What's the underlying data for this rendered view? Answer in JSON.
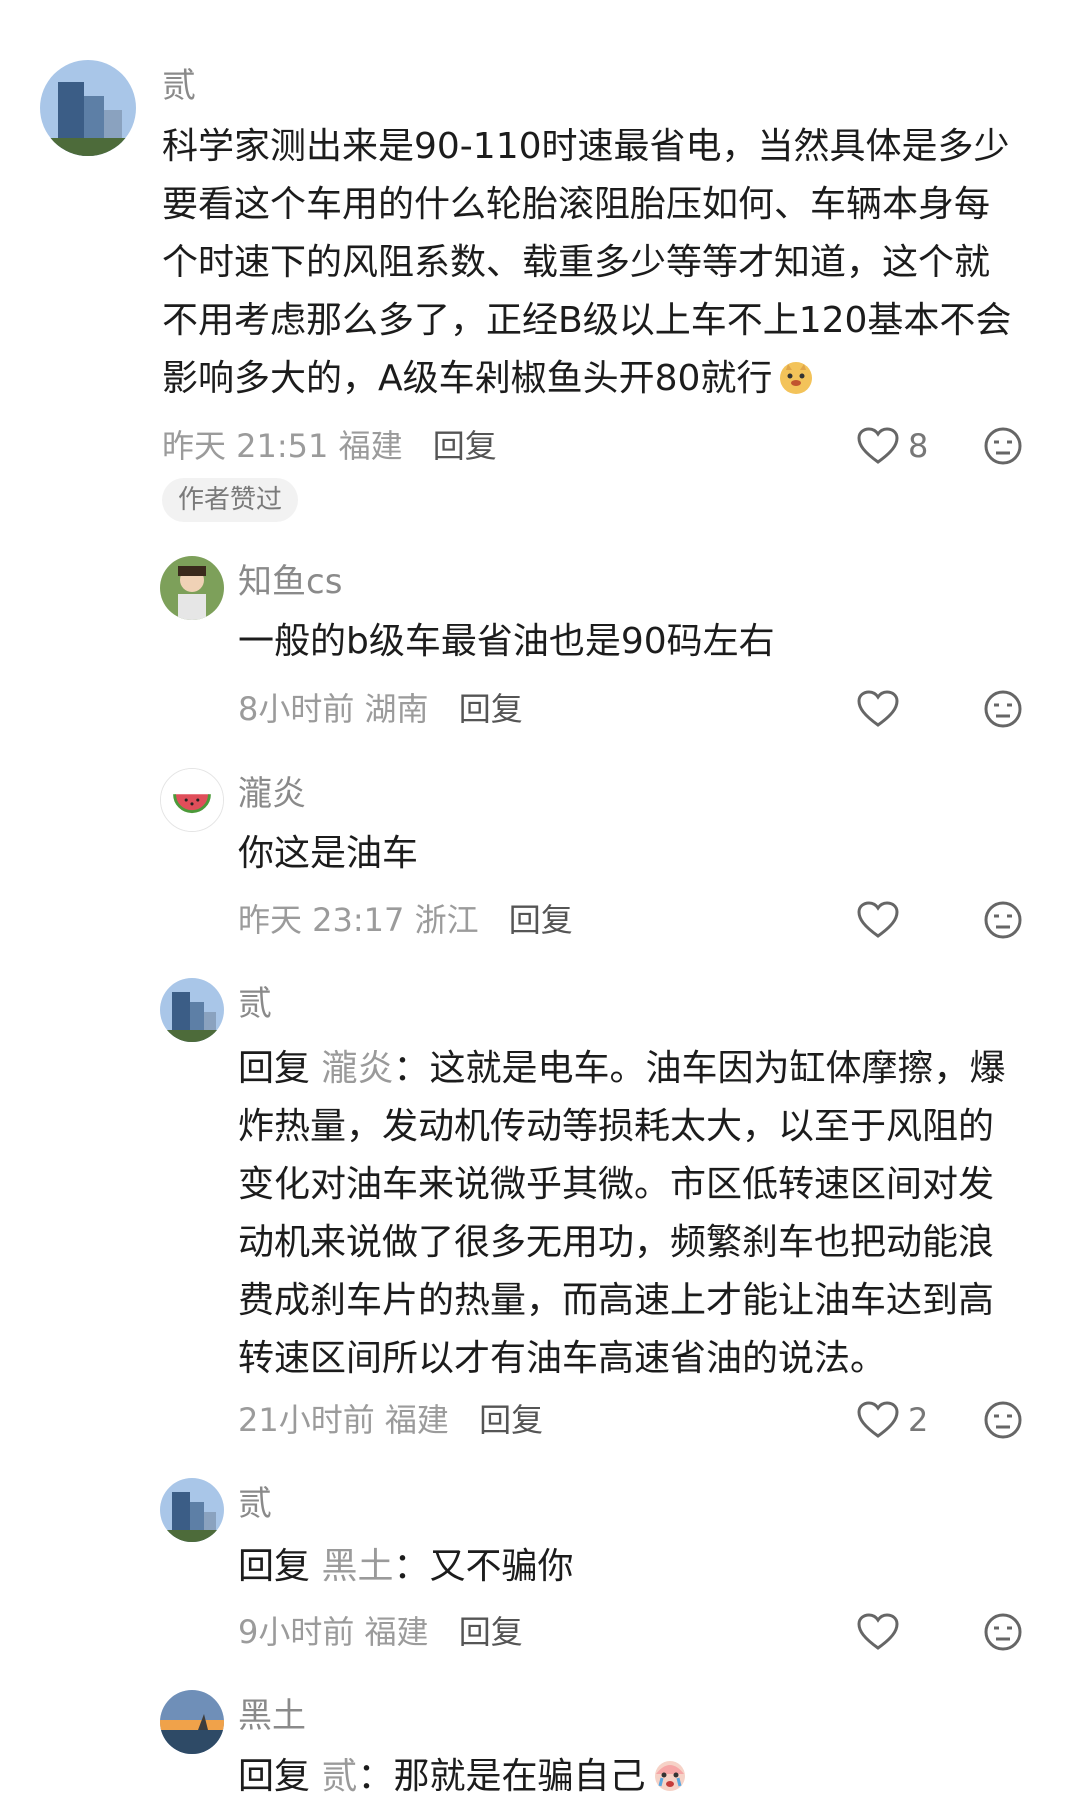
{
  "comment1": {
    "author": "贰",
    "lines": [
      "科学家测出来是90-110时速最省电，当然具体是多少",
      "要看这个车用的什么轮胎滚阻胎压如何、车辆本身每",
      "个时速下的风阻系数、载重多少等等才知道，这个就",
      "不用考虑那么多了，正经B级以上车不上120基本不会",
      "影响多大的，A级车剁椒鱼头开80就行"
    ],
    "time": "昨天 21:51",
    "location": "福建",
    "reply_label": "回复",
    "likes": "8",
    "author_tag": "作者赞过",
    "emoji": "dog-face-emoji"
  },
  "replies": [
    {
      "author": "知鱼cs",
      "lines": [
        "一般的b级车最省油也是90码左右"
      ],
      "time": "8小时前",
      "location": "湖南",
      "reply_label": "回复",
      "likes": ""
    },
    {
      "author": "瀧炎",
      "lines": [
        "你这是油车"
      ],
      "time": "昨天 23:17",
      "location": "浙江",
      "reply_label": "回复",
      "likes": ""
    },
    {
      "author": "贰",
      "reply_prefix": "回复",
      "reply_to": "瀧炎",
      "lines": [
        "：这就是电车。油车因为缸体摩擦，爆",
        "炸热量，发动机传动等损耗太大，以至于风阻的",
        "变化对油车来说微乎其微。市区低转速区间对发",
        "动机来说做了很多无用功，频繁刹车也把动能浪",
        "费成刹车片的热量，而高速上才能让油车达到高",
        "转速区间所以才有油车高速省油的说法。"
      ],
      "time": "21小时前",
      "location": "福建",
      "reply_label": "回复",
      "likes": "2"
    },
    {
      "author": "贰",
      "reply_prefix": "回复",
      "reply_to": "黑土",
      "lines": [
        "：又不骗你"
      ],
      "time": "9小时前",
      "location": "福建",
      "reply_label": "回复",
      "likes": ""
    },
    {
      "author": "黑土",
      "reply_prefix": "回复",
      "reply_to": "贰",
      "lines": [
        "：那就是在骗自己"
      ],
      "emoji": "crying-face-emoji"
    }
  ],
  "icons": {
    "like": "heart-outline-icon",
    "dislike": "neutral-face-icon"
  },
  "colors": {
    "name": "#8a8a8a",
    "meta": "#9b9b9b",
    "text": "#1c1c1c",
    "tag_bg": "#f2f2f2"
  }
}
